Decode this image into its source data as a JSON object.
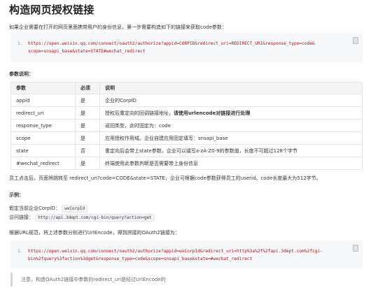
{
  "title": "构造网页授权链接",
  "intro": "如果企业需要在打开的网页里面携带用户的身份信息，第一步需要构造如下的链接来获取code参数：",
  "code_block_1": {
    "line_number": "1.",
    "text": "https://open.weixin.qq.com/connect/oauth2/authorize?appid=CORPID&redirect_uri=REDIRECT_URI&response_type=code&\nscope=snsapi_base&state=STATE#wechat_redirect"
  },
  "params_heading": "参数说明：",
  "table": {
    "headers": [
      "参数",
      "必须",
      "说明"
    ],
    "rows": [
      {
        "name": "appid",
        "required": "是",
        "desc": "企业的CorpID"
      },
      {
        "name": "redirect_uri",
        "required": "是",
        "desc": "授权后重定向的回调链接地址，",
        "desc_bold": "请使用urlencode对链接进行处理"
      },
      {
        "name": "response_type",
        "required": "是",
        "desc": "返回类型，此时固定为：code"
      },
      {
        "name": "scope",
        "required": "是",
        "desc": "应用授权作用域。企业自建应用固定填写：snsapi_base"
      },
      {
        "name": "state",
        "required": "否",
        "desc": "重定向后会带上state参数，企业可以填写a-zA-Z0-9的参数值，长度不可超过128个字节"
      },
      {
        "name": "#wechat_redirect",
        "required": "是",
        "desc": "终端使用此参数判断是否需要带上身份信息"
      }
    ]
  },
  "after_table": "员工点击后，页面将跳转至 redirect_uri?code=CODE&state=STATE，企业可根据code参数获得员工的userid。code长度最大为512字节。",
  "example_heading": "示例：",
  "example_corpid_label": "假定当前企业CorpID：",
  "example_corpid_value": "wxCorpId",
  "example_link_label": "访问链接：",
  "example_link_value": "http://api.3dept.com/cgi-bin/query?action=get",
  "encode_text": "根据URL规范，将上述参数分别进行UrlEncode，得到拼接的OAuth2链接为：",
  "code_block_2": {
    "line_number": "1.",
    "text": "https://open.weixin.qq.com/connect/oauth2/authorize?appid=wxCorpId&redirect_uri=http%3a%2f%2fapi.3dept.com%2fcgi-\nbin%2fquery%3faction%3dget&response_type=code&scope=snsapi_base&state=#wechat_redirect"
  },
  "note": "注意，构造OAuth2链接中参数的redirect_uri是经过UrlEncode的",
  "icons": {
    "copy": "copy-icon"
  }
}
